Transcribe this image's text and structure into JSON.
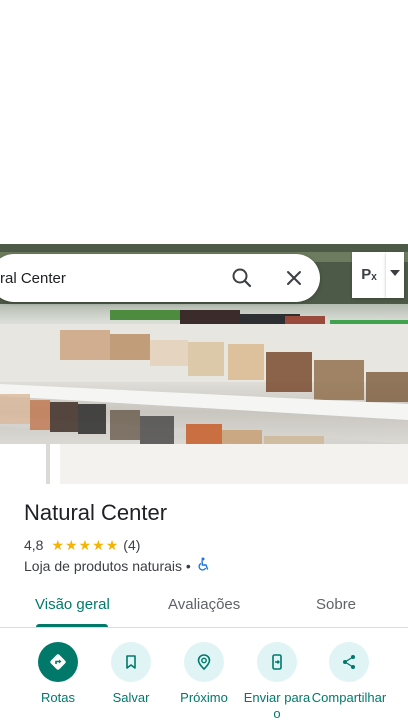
{
  "search": {
    "text": "ral Center"
  },
  "layers": {
    "button_label": "Pₓ"
  },
  "place": {
    "name": "Natural Center",
    "rating": "4,8",
    "stars_filled": 5,
    "review_count": "(4)",
    "category": "Loja de produtos naturais •"
  },
  "tabs": [
    {
      "label": "Visão geral",
      "active": true
    },
    {
      "label": "Avaliações",
      "active": false
    },
    {
      "label": "Sobre",
      "active": false
    }
  ],
  "actions": [
    {
      "label": "Rotas",
      "icon": "directions-icon"
    },
    {
      "label": "Salvar",
      "icon": "bookmark-icon"
    },
    {
      "label": "Próximo",
      "icon": "nearby-icon"
    },
    {
      "label": "Enviar para o",
      "icon": "send-to-phone-icon"
    },
    {
      "label": "Compartilhar",
      "icon": "share-icon"
    }
  ],
  "colors": {
    "accent": "#00796b",
    "star": "#f4b400",
    "action_bg": "#e0f4f5"
  }
}
